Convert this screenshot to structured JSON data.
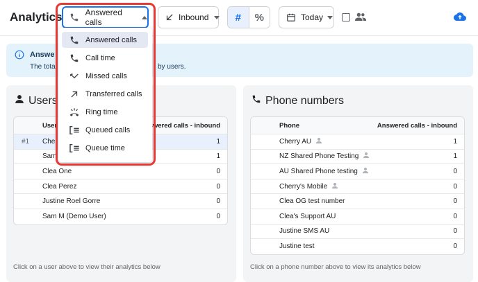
{
  "header": {
    "title": "Analytics",
    "metric_selected": "Answered calls",
    "direction_selected": "Inbound",
    "count_toggle": "#",
    "percent_toggle": "%",
    "date_selected": "Today"
  },
  "info": {
    "title": "Answe",
    "text": "The total",
    "text_tail": "by users."
  },
  "dropdown": {
    "items": [
      {
        "label": "Answered calls",
        "icon": "phone-icon"
      },
      {
        "label": "Call time",
        "icon": "phone-icon"
      },
      {
        "label": "Missed calls",
        "icon": "missed-call-icon"
      },
      {
        "label": "Transferred calls",
        "icon": "arrow-up-right-icon"
      },
      {
        "label": "Ring time",
        "icon": "ringing-phone-icon"
      },
      {
        "label": "Queued calls",
        "icon": "queue-icon"
      },
      {
        "label": "Queue time",
        "icon": "queue-icon"
      }
    ]
  },
  "users": {
    "title": "Users",
    "col_user": "User",
    "col_value": "Answered calls - inbound",
    "rows": [
      {
        "rank": "#1",
        "name": "Cher",
        "value": "1"
      },
      {
        "rank": "",
        "name": "Sam I",
        "value": "1"
      },
      {
        "rank": "",
        "name": "Clea One",
        "value": "0"
      },
      {
        "rank": "",
        "name": "Clea Perez",
        "value": "0"
      },
      {
        "rank": "",
        "name": "Justine Roel Gorre",
        "value": "0"
      },
      {
        "rank": "",
        "name": "Sam M (Demo User)",
        "value": "0"
      }
    ],
    "footer": "Click on a user above to view their analytics below"
  },
  "phones": {
    "title": "Phone numbers",
    "col_phone": "Phone",
    "col_value": "Answered calls - inbound",
    "rows": [
      {
        "name": "Cherry AU",
        "value": "1"
      },
      {
        "name": "NZ Shared Phone Testing",
        "value": "1"
      },
      {
        "name": "AU Shared Phone testing",
        "value": "0"
      },
      {
        "name": "Cherry's Mobile",
        "value": "0"
      },
      {
        "name": "Clea OG test number",
        "value": "0"
      },
      {
        "name": "Clea's Support AU",
        "value": "0"
      },
      {
        "name": "Justine SMS AU",
        "value": "0"
      },
      {
        "name": "Justine test",
        "value": "0"
      }
    ],
    "footer": "Click on a phone number above to view its analytics below"
  },
  "colors": {
    "accent": "#1a73e8",
    "highlight": "#e53935",
    "banner": "#e3f2fb"
  }
}
